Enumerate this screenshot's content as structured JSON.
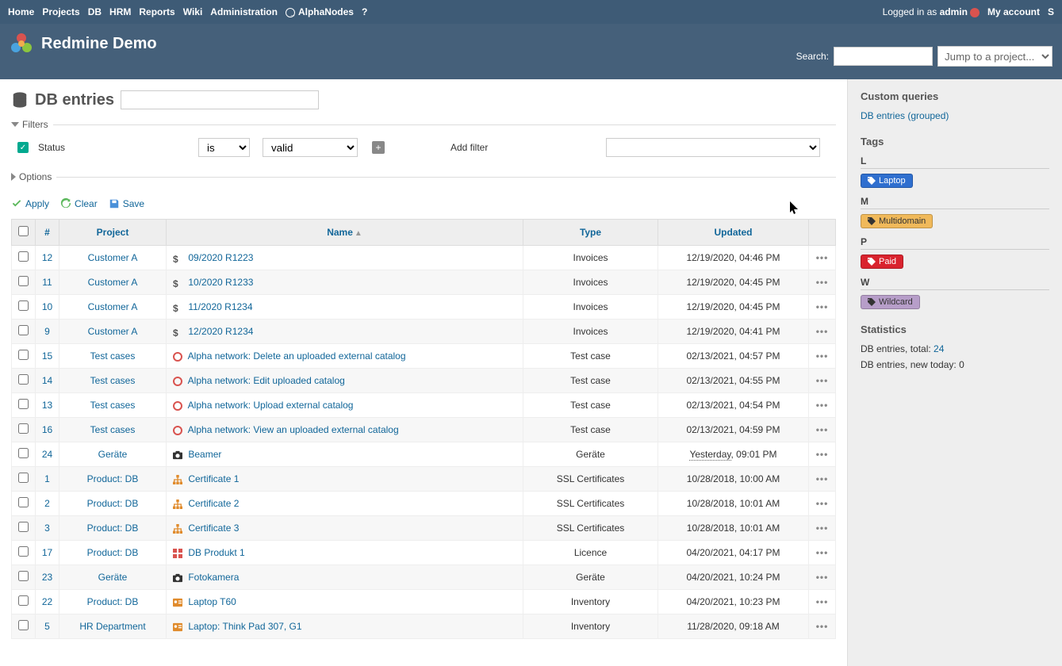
{
  "topMenu": {
    "left": [
      "Home",
      "Projects",
      "DB",
      "HRM",
      "Reports",
      "Wiki",
      "Administration",
      "AlphaNodes",
      "?"
    ],
    "loggedInAs": "Logged in as ",
    "user": "admin",
    "myAccount": "My account",
    "signOut": "S"
  },
  "header": {
    "title": "Redmine Demo",
    "searchLabel": "Search:",
    "projectJump": "Jump to a project..."
  },
  "content": {
    "title": "DB entries",
    "filtersLegend": "Filters",
    "optionsLegend": "Options",
    "statusLabel": "Status",
    "statusOp": "is",
    "statusVal": "valid",
    "addFilterLabel": "Add filter",
    "applyLabel": "Apply",
    "clearLabel": "Clear",
    "saveLabel": "Save"
  },
  "columns": {
    "chk": "",
    "id": "#",
    "project": "Project",
    "name": "Name",
    "type": "Type",
    "updated": "Updated"
  },
  "rows": [
    {
      "id": "12",
      "project": "Customer A",
      "name": "09/2020 R1223",
      "type": "Invoices",
      "updated": "12/19/2020, 04:46 PM",
      "icon": "dollar"
    },
    {
      "id": "11",
      "project": "Customer A",
      "name": "10/2020 R1233",
      "type": "Invoices",
      "updated": "12/19/2020, 04:45 PM",
      "icon": "dollar"
    },
    {
      "id": "10",
      "project": "Customer A",
      "name": "11/2020 R1234",
      "type": "Invoices",
      "updated": "12/19/2020, 04:45 PM",
      "icon": "dollar"
    },
    {
      "id": "9",
      "project": "Customer A",
      "name": "12/2020 R1234",
      "type": "Invoices",
      "updated": "12/19/2020, 04:41 PM",
      "icon": "dollar"
    },
    {
      "id": "15",
      "project": "Test cases",
      "name": "Alpha network: Delete an uploaded external catalog",
      "type": "Test case",
      "updated": "02/13/2021, 04:57 PM",
      "icon": "circle"
    },
    {
      "id": "14",
      "project": "Test cases",
      "name": "Alpha network: Edit uploaded catalog",
      "type": "Test case",
      "updated": "02/13/2021, 04:55 PM",
      "icon": "circle"
    },
    {
      "id": "13",
      "project": "Test cases",
      "name": "Alpha network: Upload external catalog",
      "type": "Test case",
      "updated": "02/13/2021, 04:54 PM",
      "icon": "circle"
    },
    {
      "id": "16",
      "project": "Test cases",
      "name": "Alpha network: View an uploaded external catalog",
      "type": "Test case",
      "updated": "02/13/2021, 04:59 PM",
      "icon": "circle"
    },
    {
      "id": "24",
      "project": "Geräte",
      "name": "Beamer",
      "type": "Geräte",
      "updated": "Yesterday, 09:01 PM",
      "icon": "camera",
      "yesterday": true
    },
    {
      "id": "1",
      "project": "Product: DB",
      "name": "Certificate 1",
      "type": "SSL Certificates",
      "updated": "10/28/2018, 10:00 AM",
      "icon": "cert"
    },
    {
      "id": "2",
      "project": "Product: DB",
      "name": "Certificate 2",
      "type": "SSL Certificates",
      "updated": "10/28/2018, 10:01 AM",
      "icon": "cert"
    },
    {
      "id": "3",
      "project": "Product: DB",
      "name": "Certificate 3",
      "type": "SSL Certificates",
      "updated": "10/28/2018, 10:01 AM",
      "icon": "cert"
    },
    {
      "id": "17",
      "project": "Product: DB",
      "name": "DB Produkt 1",
      "type": "Licence",
      "updated": "04/20/2021, 04:17 PM",
      "icon": "grid"
    },
    {
      "id": "23",
      "project": "Geräte",
      "name": "Fotokamera",
      "type": "Geräte",
      "updated": "04/20/2021, 10:24 PM",
      "icon": "camera"
    },
    {
      "id": "22",
      "project": "Product: DB",
      "name": "Laptop T60",
      "type": "Inventory",
      "updated": "04/20/2021, 10:23 PM",
      "icon": "inv"
    },
    {
      "id": "5",
      "project": "HR Department",
      "name": "Laptop: Think Pad 307, G1",
      "type": "Inventory",
      "updated": "11/28/2020, 09:18 AM",
      "icon": "inv"
    }
  ],
  "sidebar": {
    "customQueries": "Custom queries",
    "queryLink": "DB entries (grouped)",
    "tagsTitle": "Tags",
    "letters": {
      "L": "L",
      "M": "M",
      "P": "P",
      "W": "W"
    },
    "tags": {
      "laptop": "Laptop",
      "multidomain": "Multidomain",
      "paid": "Paid",
      "wildcard": "Wildcard"
    },
    "statsTitle": "Statistics",
    "totalLabel": "DB entries, total: ",
    "totalValue": "24",
    "newTodayLabel": "DB entries, new today: ",
    "newTodayValue": "0"
  }
}
